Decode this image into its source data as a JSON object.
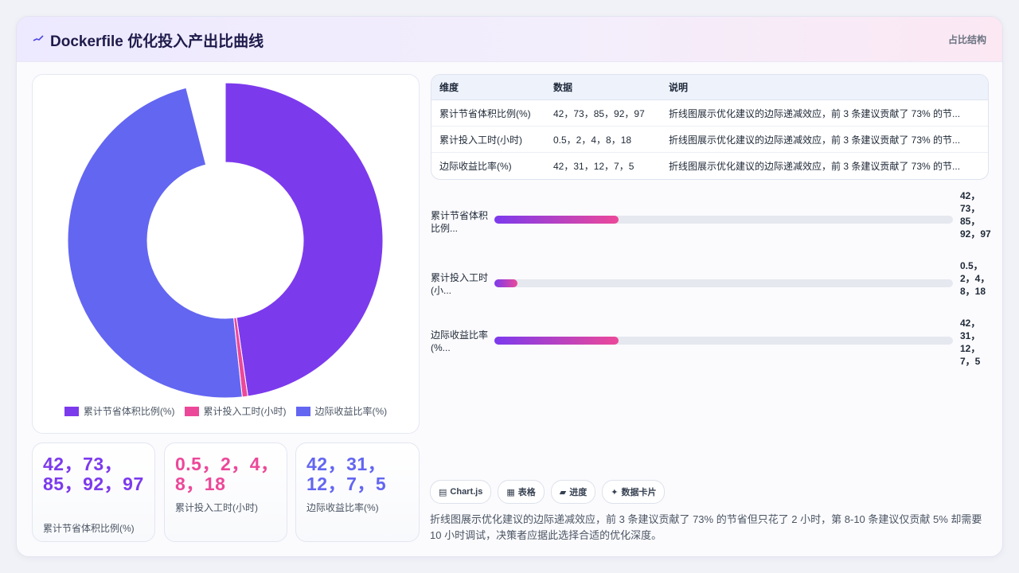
{
  "header": {
    "title": "Dockerfile 优化投入产出比曲线",
    "badge": "占比结构",
    "icon": "trend-line-icon"
  },
  "colors": {
    "series1": "#7c3aed",
    "series2": "#ec4899",
    "series3": "#6366f1",
    "bar_gradient_start": "#7c3aed",
    "bar_gradient_end": "#ec4899"
  },
  "chart_data": {
    "type": "pie",
    "variant": "doughnut",
    "labels": [
      "累计节省体积比例(%)",
      "累计投入工时(小时)",
      "边际收益比率(%)"
    ],
    "values": [
      42,
      0.5,
      42
    ],
    "colors": [
      "#7c3aed",
      "#ec4899",
      "#6366f1"
    ],
    "legend_position": "bottom"
  },
  "stats": [
    {
      "value": "42，73，85，92，97",
      "label": "累计节省体积比例(%)",
      "color": "#7c3aed"
    },
    {
      "value": "0.5，2，4，8，18",
      "label": "累计投入工时(小时)",
      "color": "#ec4899"
    },
    {
      "value": "42，31，12，7，5",
      "label": "边际收益比率(%)",
      "color": "#6366f1"
    }
  ],
  "table": {
    "headers": [
      "维度",
      "数据",
      "说明"
    ],
    "rows": [
      [
        "累计节省体积比例(%)",
        "42，73，85，92，97",
        "折线图展示优化建议的边际递减效应，前 3 条建议贡献了 73% 的节..."
      ],
      [
        "累计投入工时(小时)",
        "0.5，2，4，8，18",
        "折线图展示优化建议的边际递减效应，前 3 条建议贡献了 73% 的节..."
      ],
      [
        "边际收益比率(%)",
        "42，31，12，7，5",
        "折线图展示优化建议的边际递减效应，前 3 条建议贡献了 73% 的节..."
      ]
    ]
  },
  "bars": [
    {
      "label": "累计节省体积比例...",
      "value": "42，73，85，92，97",
      "fill": 0.27
    },
    {
      "label": "累计投入工时(小...",
      "value": "0.5，2，4，8，18",
      "fill": 0.05
    },
    {
      "label": "边际收益比率(%...",
      "value": "42，31，12，7，5",
      "fill": 0.27
    }
  ],
  "tags": [
    {
      "icon": "chart-icon",
      "glyph": "▤",
      "label": "Chart.js"
    },
    {
      "icon": "table-icon",
      "glyph": "▦",
      "label": "表格"
    },
    {
      "icon": "progress-icon",
      "glyph": "▰",
      "label": "进度"
    },
    {
      "icon": "sparkle-icon",
      "glyph": "✦",
      "label": "数据卡片"
    }
  ],
  "description": "折线图展示优化建议的边际递减效应，前 3 条建议贡献了 73% 的节省但只花了 2 小时，第 8-10 条建议仅贡献 5% 却需要 10 小时调试，决策者应据此选择合适的优化深度。"
}
